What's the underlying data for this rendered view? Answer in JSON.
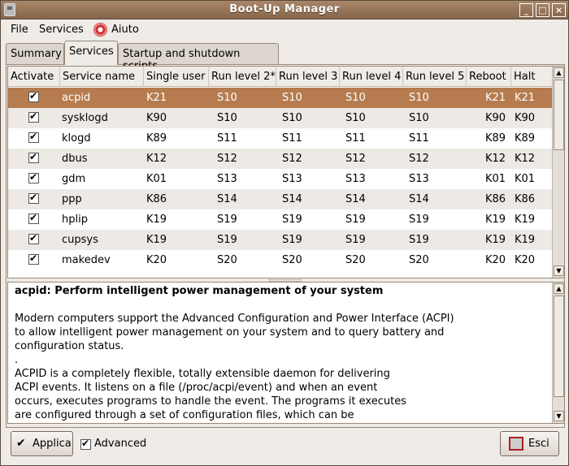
{
  "window": {
    "title": "Boot-Up Manager"
  },
  "menubar": {
    "file": "File",
    "services": "Services",
    "help": "Aiuto"
  },
  "tabs": [
    {
      "label": "Summary"
    },
    {
      "label": "Services"
    },
    {
      "label": "Startup and shutdown scripts"
    }
  ],
  "table": {
    "headers": [
      "Activate",
      "Service name",
      "Single user",
      "Run level 2*",
      "Run level 3",
      "Run level 4",
      "Run level 5",
      "Reboot",
      "Halt"
    ],
    "rows": [
      {
        "active": true,
        "name": "acpid",
        "single": "K21",
        "rl2": "S10",
        "rl3": "S10",
        "rl4": "S10",
        "rl5": "S10",
        "reboot": "K21",
        "halt": "K21"
      },
      {
        "active": true,
        "name": "sysklogd",
        "single": "K90",
        "rl2": "S10",
        "rl3": "S10",
        "rl4": "S10",
        "rl5": "S10",
        "reboot": "K90",
        "halt": "K90"
      },
      {
        "active": true,
        "name": "klogd",
        "single": "K89",
        "rl2": "S11",
        "rl3": "S11",
        "rl4": "S11",
        "rl5": "S11",
        "reboot": "K89",
        "halt": "K89"
      },
      {
        "active": true,
        "name": "dbus",
        "single": "K12",
        "rl2": "S12",
        "rl3": "S12",
        "rl4": "S12",
        "rl5": "S12",
        "reboot": "K12",
        "halt": "K12"
      },
      {
        "active": true,
        "name": "gdm",
        "single": "K01",
        "rl2": "S13",
        "rl3": "S13",
        "rl4": "S13",
        "rl5": "S13",
        "reboot": "K01",
        "halt": "K01"
      },
      {
        "active": true,
        "name": "ppp",
        "single": "K86",
        "rl2": "S14",
        "rl3": "S14",
        "rl4": "S14",
        "rl5": "S14",
        "reboot": "K86",
        "halt": "K86"
      },
      {
        "active": true,
        "name": "hplip",
        "single": "K19",
        "rl2": "S19",
        "rl3": "S19",
        "rl4": "S19",
        "rl5": "S19",
        "reboot": "K19",
        "halt": "K19"
      },
      {
        "active": true,
        "name": "cupsys",
        "single": "K19",
        "rl2": "S19",
        "rl3": "S19",
        "rl4": "S19",
        "rl5": "S19",
        "reboot": "K19",
        "halt": "K19"
      },
      {
        "active": true,
        "name": "makedev",
        "single": "K20",
        "rl2": "S20",
        "rl3": "S20",
        "rl4": "S20",
        "rl5": "S20",
        "reboot": "K20",
        "halt": "K20"
      }
    ]
  },
  "description": {
    "heading": "acpid: Perform intelligent power management of your system",
    "lines": [
      "",
      "Modern computers support the Advanced Configuration and Power Interface (ACPI)",
      "to allow intelligent power management on your system and to query battery and",
      "configuration status.",
      ".",
      "ACPID is a completely flexible, totally extensible daemon for delivering",
      "ACPI events. It listens on a file (/proc/acpi/event) and when an event",
      "occurs, executes programs to handle the event. The programs it executes",
      "are configured through a set of configuration files, which can be"
    ]
  },
  "footer": {
    "apply": "Applica",
    "advanced": "Advanced",
    "exit": "Esci"
  },
  "colors": {
    "titlebar": "#96735a",
    "selection": "#b67c4f"
  },
  "icons": [
    "window-menu-icon",
    "minimize-icon",
    "maximize-icon",
    "close-icon",
    "help-lifebuoy-icon",
    "checkmark-icon",
    "exit-door-icon"
  ]
}
